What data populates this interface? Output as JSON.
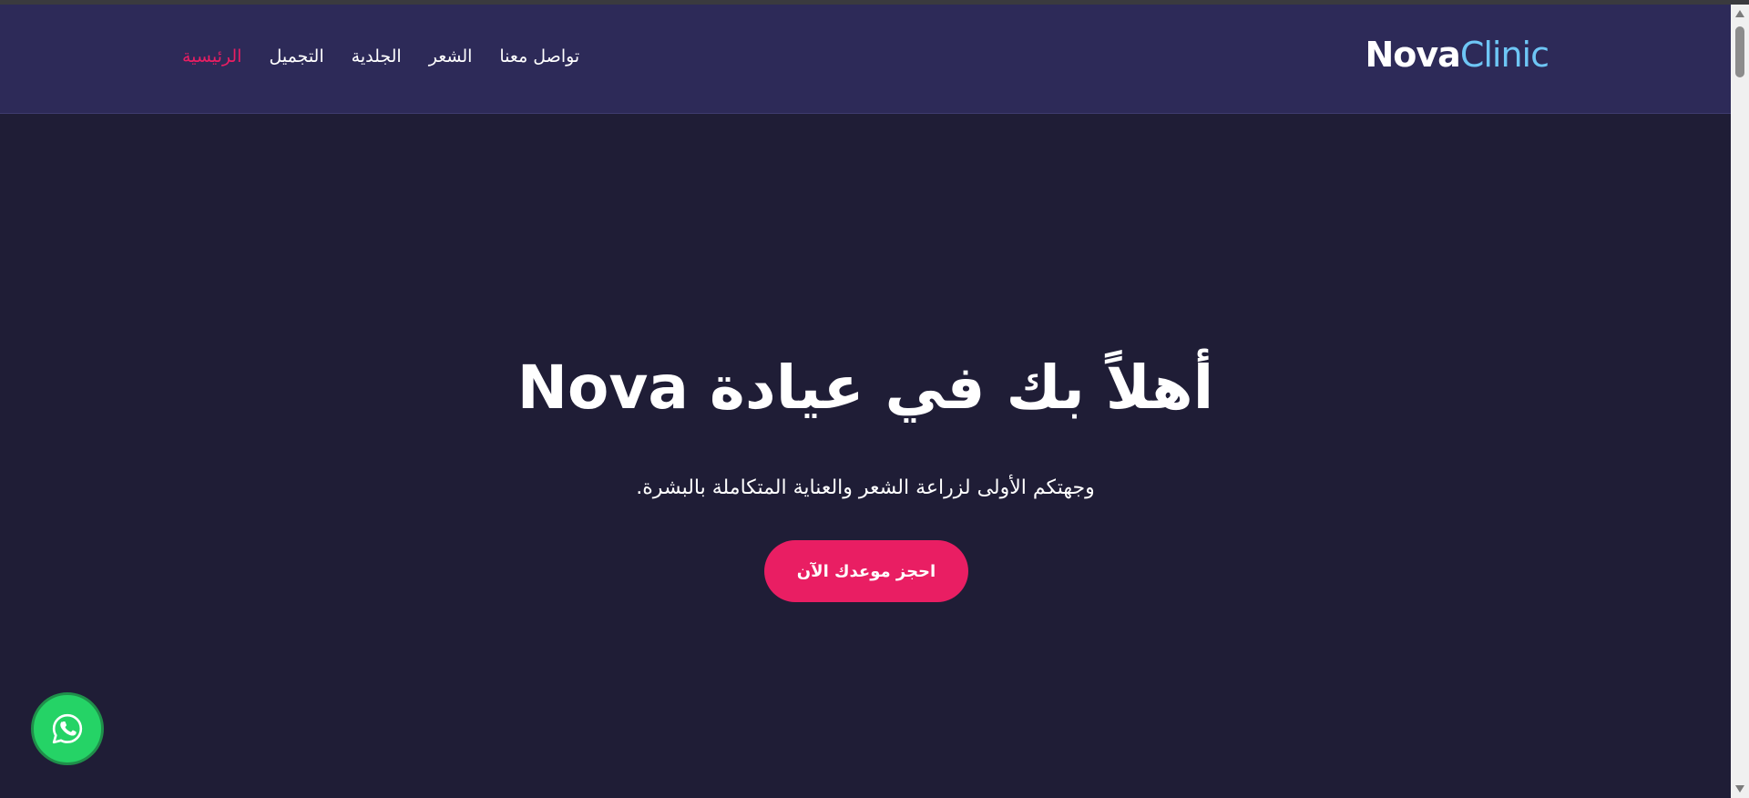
{
  "brand": {
    "part1": "Nova",
    "part2": "Clinic"
  },
  "nav": {
    "items": [
      {
        "label": "الرئيسية",
        "active": true
      },
      {
        "label": "التجميل",
        "active": false
      },
      {
        "label": "الجلدية",
        "active": false
      },
      {
        "label": "الشعر",
        "active": false
      },
      {
        "label": "تواصل معنا",
        "active": false
      }
    ]
  },
  "hero": {
    "title": "أهلاً بك في عيادة Nova",
    "subtitle": "وجهتكم الأولى لزراعة الشعر والعناية المتكاملة بالبشرة.",
    "cta_label": "احجز موعدك الآن"
  },
  "floating": {
    "icon": "whatsapp-icon"
  },
  "colors": {
    "background": "#1f1d36",
    "navbar": "#2d2a58",
    "accent": "#e91e63",
    "brand_highlight": "#6ec6f5",
    "whatsapp": "#25d366"
  }
}
